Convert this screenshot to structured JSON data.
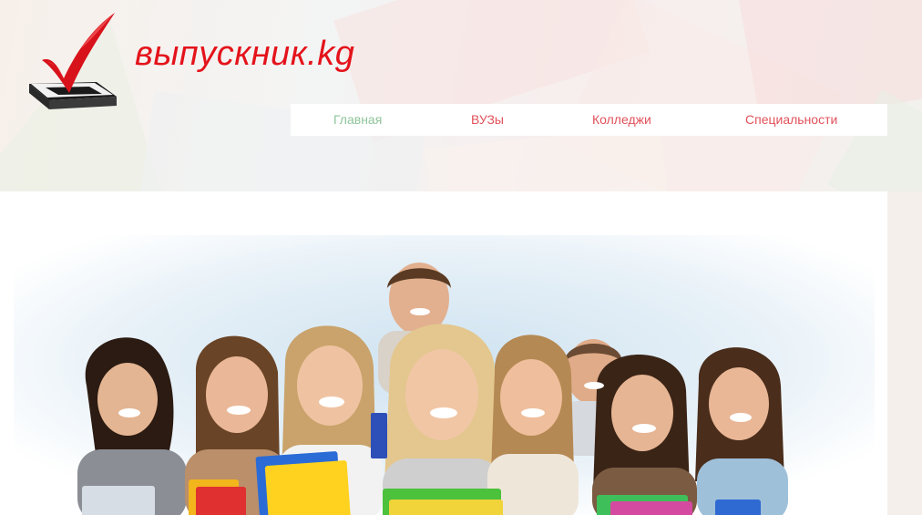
{
  "site": {
    "logo_text": "выпускник.kg",
    "logo_icon": "checkmark-ballot-icon",
    "brand_color": "#e4131b"
  },
  "nav": {
    "items": [
      {
        "label": "Главная",
        "active": true,
        "color": "#8fc49a"
      },
      {
        "label": "ВУЗы",
        "active": false,
        "color": "#e1515a"
      },
      {
        "label": "Колледжи",
        "active": false,
        "color": "#e1515a"
      },
      {
        "label": "Специальности",
        "active": false,
        "color": "#e1515a"
      }
    ]
  },
  "hero": {
    "image_subject": "group-of-students-photo"
  }
}
